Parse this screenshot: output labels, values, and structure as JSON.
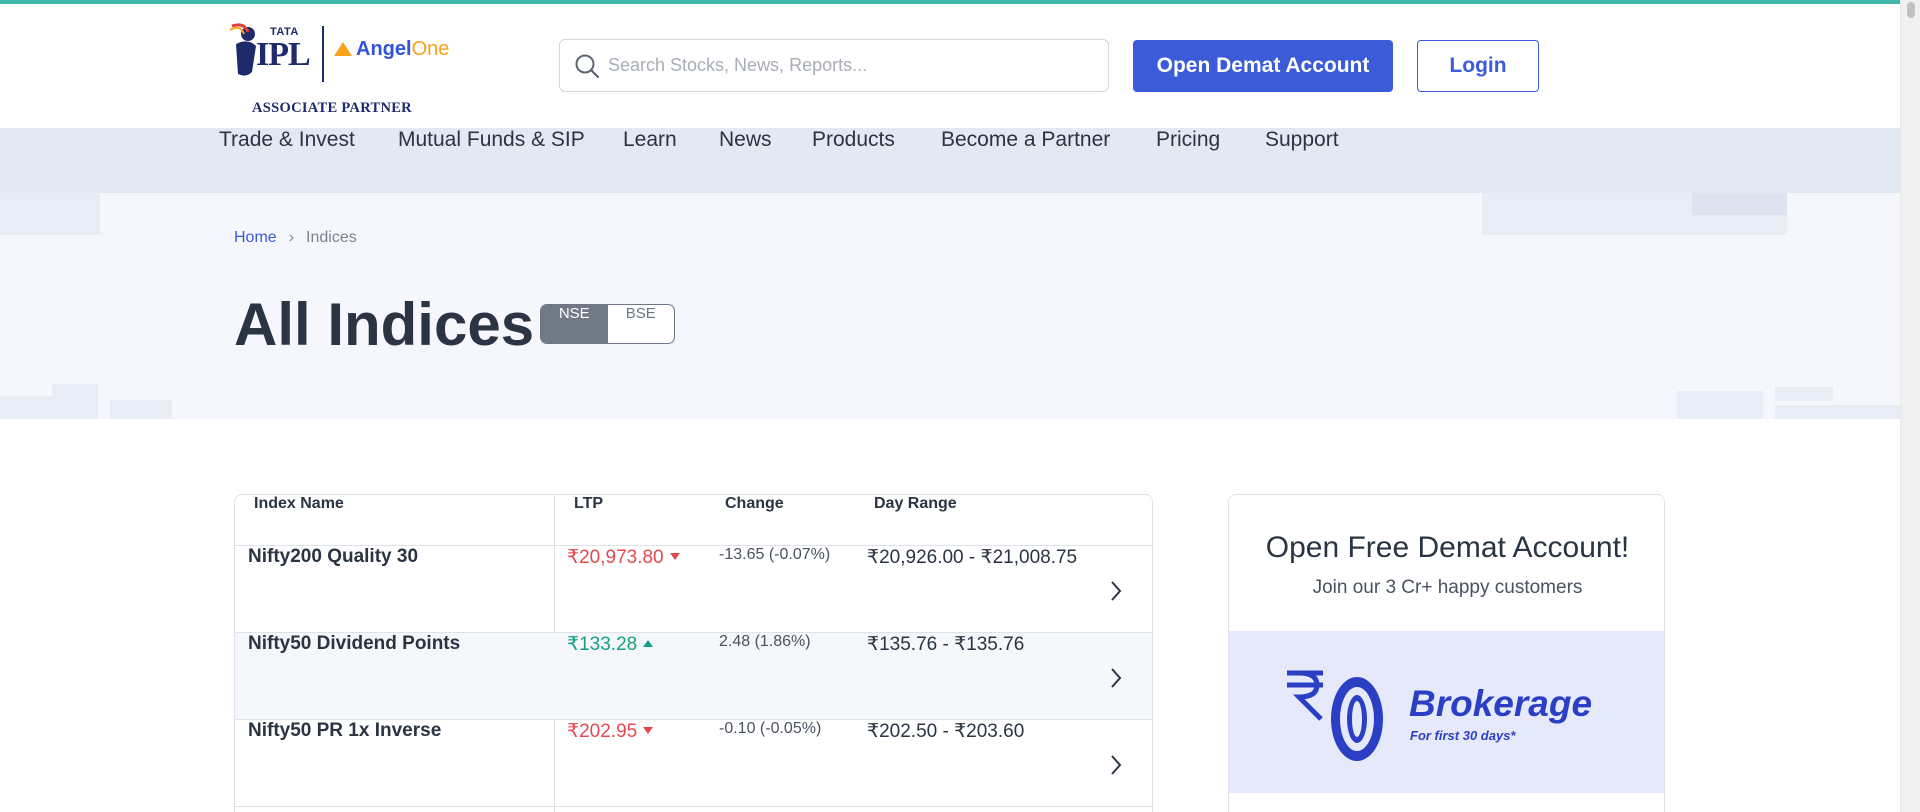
{
  "brand": {
    "tata_label": "TATA",
    "ipl_label": "IPL",
    "partner_name": "AngelOne",
    "partner_name_main": "Angel",
    "partner_name_accent": "One",
    "associate_label": "ASSOCIATE PARTNER"
  },
  "header": {
    "search_placeholder": "Search Stocks, News, Reports...",
    "search_value": "",
    "open_demat_label": "Open Demat Account",
    "login_label": "Login"
  },
  "nav": {
    "items": [
      {
        "label": "Trade & Invest"
      },
      {
        "label": "Mutual Funds & SIP"
      },
      {
        "label": "Learn"
      },
      {
        "label": "News"
      },
      {
        "label": "Products"
      },
      {
        "label": "Become a Partner"
      },
      {
        "label": "Pricing"
      },
      {
        "label": "Support"
      }
    ]
  },
  "breadcrumb": {
    "home": "Home",
    "separator": "›",
    "current": "Indices"
  },
  "page": {
    "title": "All Indices",
    "exchange_options": [
      "NSE",
      "BSE"
    ],
    "selected_exchange": "NSE"
  },
  "table": {
    "headers": {
      "name": "Index Name",
      "ltp": "LTP",
      "change": "Change",
      "range": "Day Range"
    },
    "rows": [
      {
        "name": "Nifty200 Quality 30",
        "ltp": "₹20,973.80",
        "direction": "down",
        "change": "-13.65 (-0.07%)",
        "range": "₹20,926.00 - ₹21,008.75"
      },
      {
        "name": "Nifty50 Dividend Points",
        "ltp": "₹133.28",
        "direction": "up",
        "change": "2.48 (1.86%)",
        "range": "₹135.76 - ₹135.76"
      },
      {
        "name": "Nifty50 PR 1x Inverse",
        "ltp": "₹202.95",
        "direction": "down",
        "change": "-0.10 (-0.05%)",
        "range": "₹202.50 - ₹203.60"
      }
    ]
  },
  "promo": {
    "title": "Open Free Demat Account!",
    "subtitle": "Join our 3 Cr+ happy customers",
    "headline": "Brokerage",
    "note": "For first 30 days*"
  },
  "colors": {
    "accent_teal": "#3fb8a9",
    "primary_blue": "#3b5bd9",
    "down_red": "#e5484d",
    "up_green": "#16a085",
    "nav_bg": "#e2e9f3"
  },
  "icons": {
    "search": "search-icon",
    "row_action": "chevron-right-icon",
    "up": "triangle-up-icon",
    "down": "triangle-down-icon"
  }
}
